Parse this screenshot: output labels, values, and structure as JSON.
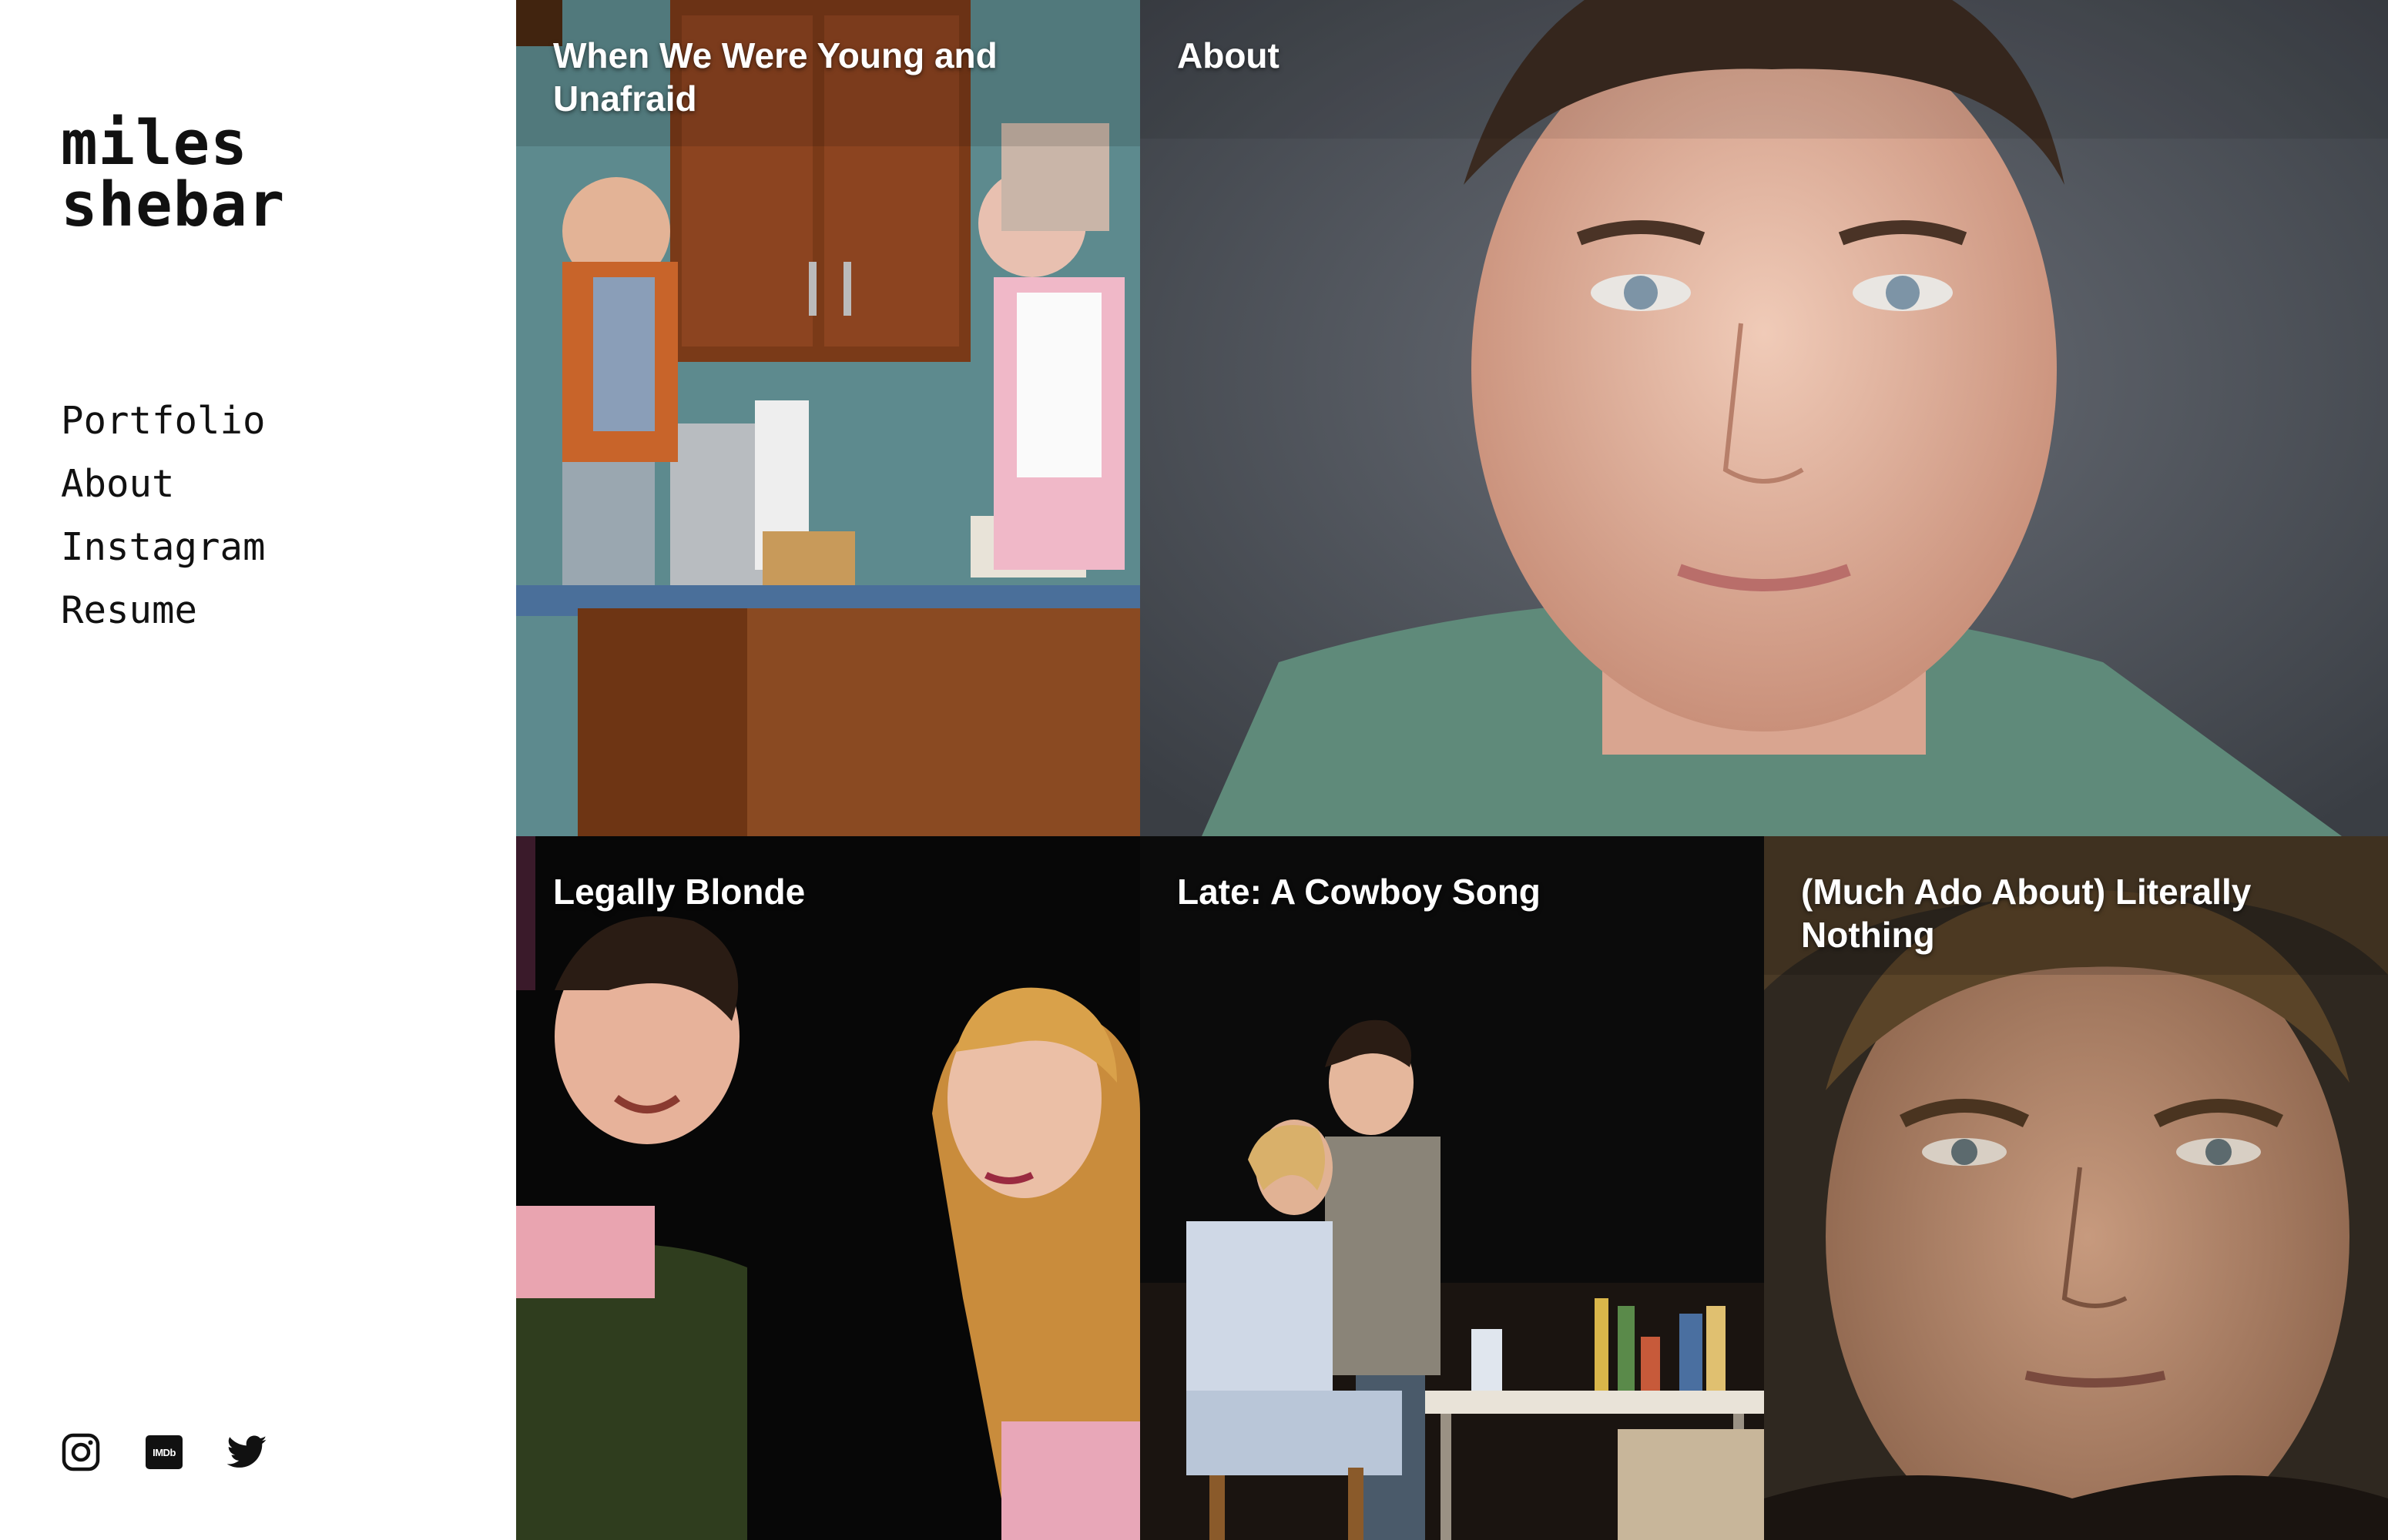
{
  "site": {
    "logo_line1": "miles",
    "logo_line2": "shebar"
  },
  "nav": {
    "items": [
      {
        "label": "Portfolio"
      },
      {
        "label": "About"
      },
      {
        "label": "Instagram"
      },
      {
        "label": "Resume"
      }
    ]
  },
  "social": {
    "instagram_icon": "instagram-icon",
    "imdb_icon": "imdb-icon",
    "imdb_text": "IMDb",
    "twitter_icon": "twitter-icon"
  },
  "grid": {
    "tiles": [
      {
        "title": "When We Were Young and Unafraid"
      },
      {
        "title": "About"
      },
      {
        "title": "Legally Blonde"
      },
      {
        "title": "Late: A Cowboy Song"
      },
      {
        "title": "(Much Ado About) Literally Nothing"
      }
    ]
  },
  "colors": {
    "text": "#111111",
    "background": "#ffffff",
    "tile_title": "#ffffff"
  }
}
